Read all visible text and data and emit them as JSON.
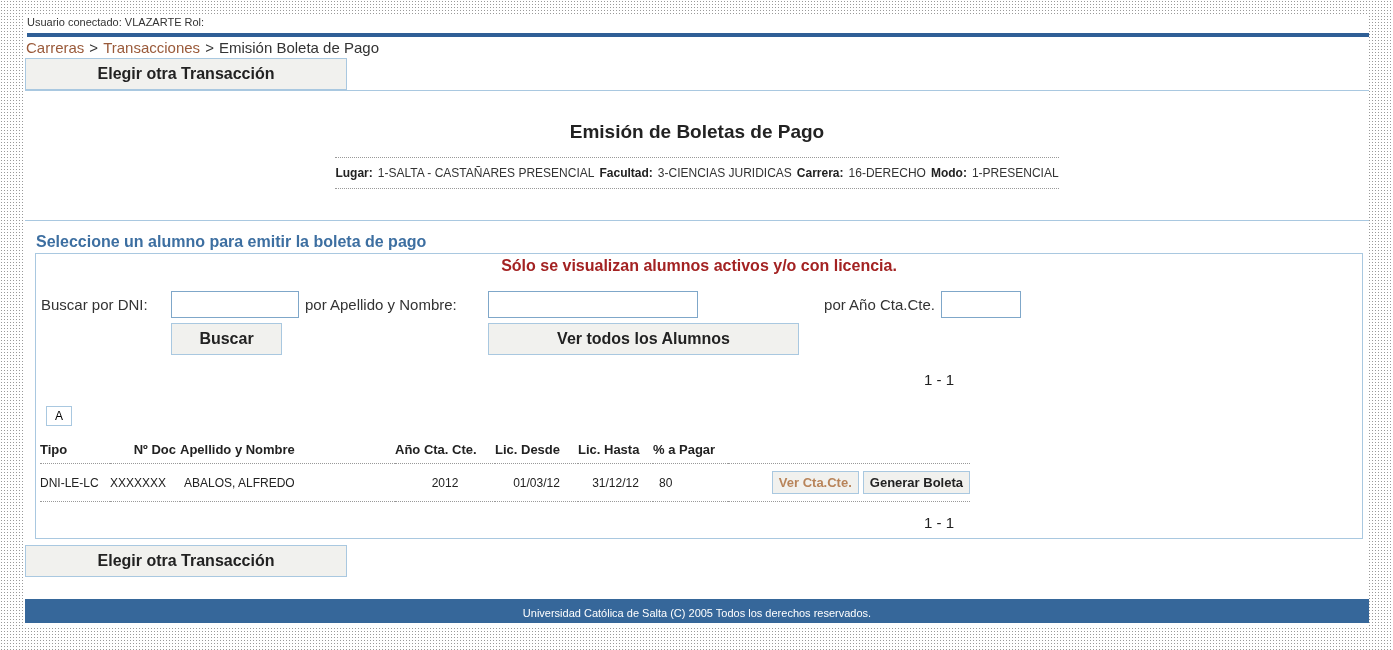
{
  "user_bar": "Usuario conectado: VLAZARTE Rol:",
  "breadcrumb": [
    {
      "label": "Carreras",
      "link": true
    },
    {
      "label": ">",
      "link": false
    },
    {
      "label": "Transacciones",
      "link": true
    },
    {
      "label": ">",
      "link": false
    },
    {
      "label": "Emisión Boleta de Pago",
      "link": false
    }
  ],
  "top_button": "Elegir otra Transacción",
  "header": {
    "title": "Emisión de Boletas de Pago",
    "info": [
      {
        "label": "Lugar:",
        "value": "1-SALTA - CASTAÑARES PRESENCIAL"
      },
      {
        "label": "Facultad:",
        "value": "3-CIENCIAS JURIDICAS"
      },
      {
        "label": "Carrera:",
        "value": "16-DERECHO"
      },
      {
        "label": "Modo:",
        "value": "1-PRESENCIAL"
      }
    ]
  },
  "section_title": "Seleccione un alumno para emitir la boleta de pago",
  "notice": "Sólo se visualizan alumnos activos y/o con licencia.",
  "search": {
    "fields": [
      {
        "label": "Buscar por DNI:"
      },
      {
        "label": "por Apellido y Nombre:"
      },
      {
        "label": "por Año Cta.Cte."
      }
    ],
    "buttons": [
      "Buscar",
      "Ver todos los Alumnos"
    ]
  },
  "pagination_top": "1 - 1",
  "letters": [
    "A"
  ],
  "table": {
    "columns": [
      "Tipo",
      "Nº Doc",
      "Apellido y Nombre",
      "Año Cta. Cte.",
      "Lic. Desde",
      "Lic. Hasta",
      "% a Pagar"
    ],
    "rows": [
      {
        "cells": [
          "DNI-LE-LC",
          "XXXXXXX",
          "ABALOS, ALFREDO",
          "2012",
          "01/03/12",
          "31/12/12",
          "80"
        ],
        "actions": [
          {
            "label": "Ver Cta.Cte.",
            "kind": "link"
          },
          {
            "label": "Generar Boleta",
            "kind": "primary"
          }
        ]
      }
    ]
  },
  "pagination_bottom": "1 - 1",
  "bottom_button": "Elegir otra Transacción",
  "footer": "Universidad Católica de Salta (C) 2005 Todos los derechos reservados."
}
